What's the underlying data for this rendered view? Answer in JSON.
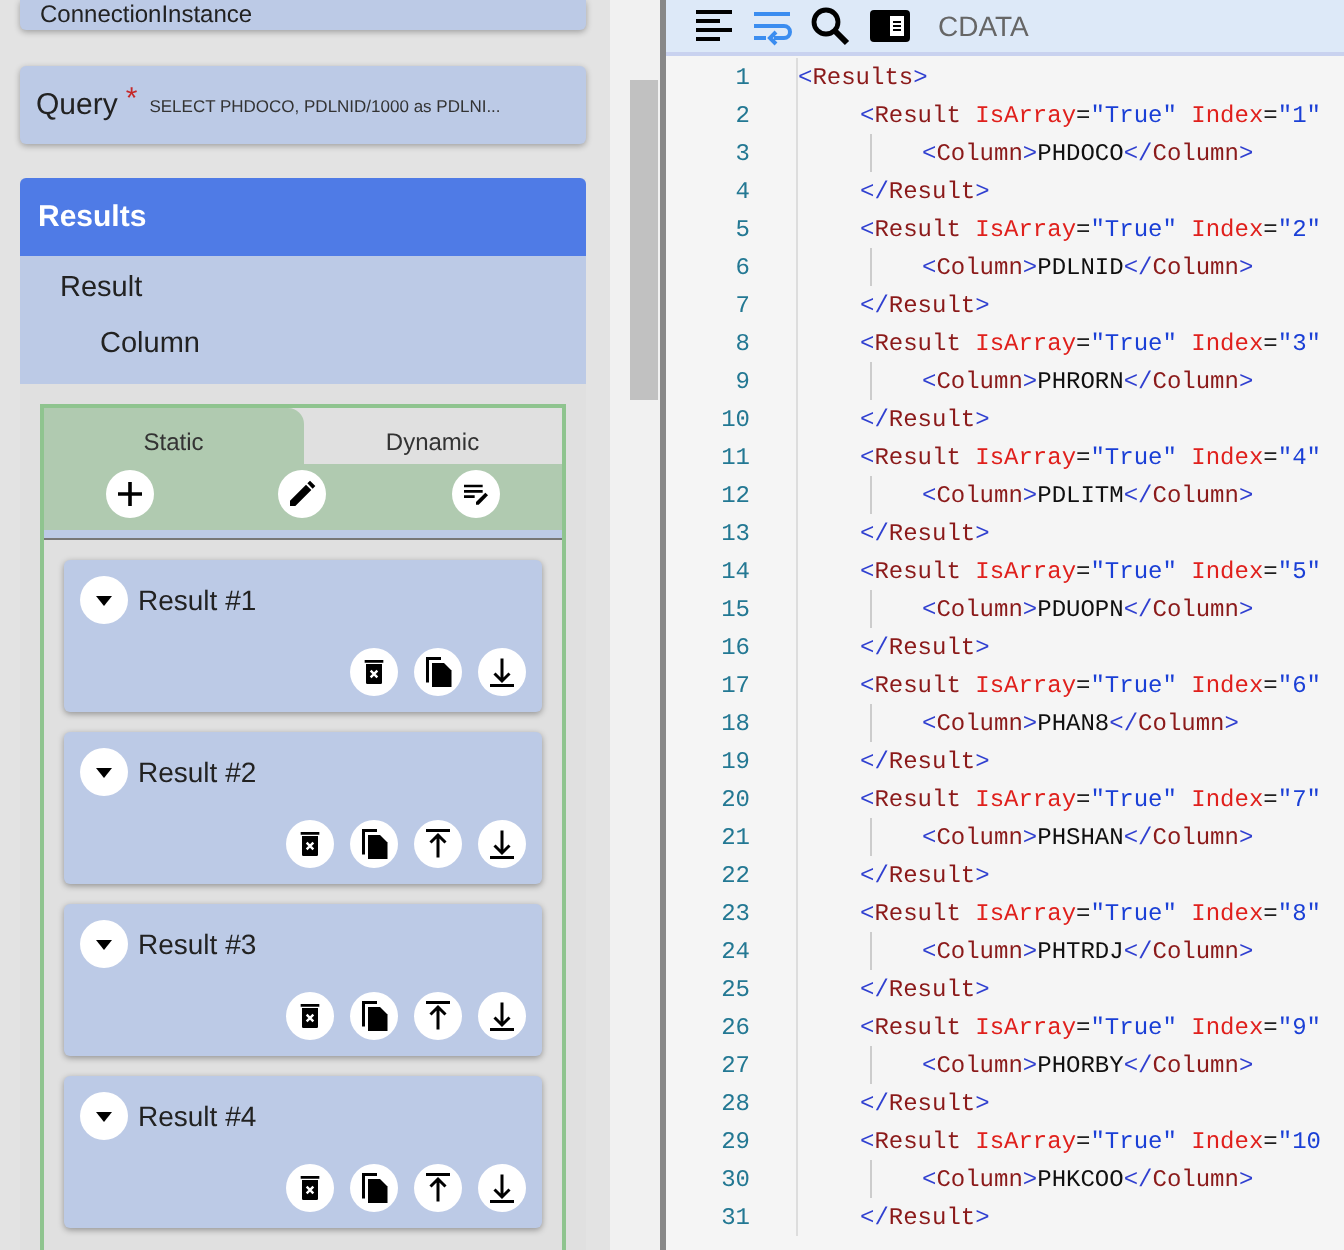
{
  "left_panel": {
    "connection_card": {
      "label": "ConnectionInstance"
    },
    "query": {
      "label": "Query",
      "required_mark": "*",
      "value": "SELECT PHDOCO, PDLNID/1000 as PDLNI..."
    },
    "results_section": {
      "title": "Results",
      "tree": [
        {
          "label": "Result",
          "children": [
            {
              "label": "Column"
            }
          ]
        }
      ],
      "tabs": [
        {
          "label": "Static",
          "selected": true
        },
        {
          "label": "Dynamic",
          "selected": false
        }
      ],
      "tab_actions": [
        {
          "kind": "add"
        },
        {
          "kind": "edit"
        },
        {
          "kind": "edit-list"
        }
      ],
      "results": [
        {
          "title": "Result #1",
          "actions": [
            {
              "kind": "delete"
            },
            {
              "kind": "copy"
            },
            {
              "kind": "move-down"
            }
          ]
        },
        {
          "title": "Result #2",
          "actions": [
            {
              "kind": "delete"
            },
            {
              "kind": "copy"
            },
            {
              "kind": "move-up"
            },
            {
              "kind": "move-down"
            }
          ]
        },
        {
          "title": "Result #3",
          "actions": [
            {
              "kind": "delete"
            },
            {
              "kind": "copy"
            },
            {
              "kind": "move-up"
            },
            {
              "kind": "move-down"
            }
          ]
        },
        {
          "title": "Result #4",
          "actions": [
            {
              "kind": "delete"
            },
            {
              "kind": "copy"
            },
            {
              "kind": "move-up"
            },
            {
              "kind": "move-down"
            }
          ]
        }
      ]
    }
  },
  "editor": {
    "toolbar": [
      {
        "kind": "format",
        "selected": false
      },
      {
        "kind": "wrap",
        "selected": true
      },
      {
        "kind": "search",
        "selected": false
      },
      {
        "kind": "panel",
        "selected": false
      },
      {
        "kind": "text",
        "label": "CDATA",
        "selected": false
      }
    ],
    "lines": [
      {
        "number": "1",
        "tokens": [
          {
            "kind": "bracket",
            "text": "<"
          },
          {
            "kind": "tag",
            "text": "Results"
          },
          {
            "kind": "bracket",
            "text": ">"
          }
        ],
        "children": [
          {
            "number": "2",
            "tokens": [
              {
                "kind": "bracket",
                "text": "<"
              },
              {
                "kind": "tag",
                "text": "Result"
              },
              {
                "kind": "attr",
                "text": " IsArray"
              },
              {
                "kind": "eq",
                "text": "="
              },
              {
                "kind": "value",
                "text": "\"True\""
              },
              {
                "kind": "attr",
                "text": " Index"
              },
              {
                "kind": "eq",
                "text": "="
              },
              {
                "kind": "value",
                "text": "\"1\""
              }
            ],
            "children": [
              {
                "number": "3",
                "tokens": [
                  {
                    "kind": "bracket",
                    "text": "<"
                  },
                  {
                    "kind": "tag",
                    "text": "Column"
                  },
                  {
                    "kind": "bracket",
                    "text": ">"
                  },
                  {
                    "kind": "text",
                    "text": "PHDOCO"
                  },
                  {
                    "kind": "bracket",
                    "text": "</"
                  },
                  {
                    "kind": "tag",
                    "text": "Column"
                  },
                  {
                    "kind": "bracket",
                    "text": ">"
                  }
                ]
              }
            ]
          },
          {
            "number": "4",
            "tokens": [
              {
                "kind": "bracket",
                "text": "</"
              },
              {
                "kind": "tag",
                "text": "Result"
              },
              {
                "kind": "bracket",
                "text": ">"
              }
            ]
          },
          {
            "number": "5",
            "tokens": [
              {
                "kind": "bracket",
                "text": "<"
              },
              {
                "kind": "tag",
                "text": "Result"
              },
              {
                "kind": "attr",
                "text": " IsArray"
              },
              {
                "kind": "eq",
                "text": "="
              },
              {
                "kind": "value",
                "text": "\"True\""
              },
              {
                "kind": "attr",
                "text": " Index"
              },
              {
                "kind": "eq",
                "text": "="
              },
              {
                "kind": "value",
                "text": "\"2\""
              }
            ],
            "children": [
              {
                "number": "6",
                "tokens": [
                  {
                    "kind": "bracket",
                    "text": "<"
                  },
                  {
                    "kind": "tag",
                    "text": "Column"
                  },
                  {
                    "kind": "bracket",
                    "text": ">"
                  },
                  {
                    "kind": "text",
                    "text": "PDLNID"
                  },
                  {
                    "kind": "bracket",
                    "text": "</"
                  },
                  {
                    "kind": "tag",
                    "text": "Column"
                  },
                  {
                    "kind": "bracket",
                    "text": ">"
                  }
                ]
              }
            ]
          },
          {
            "number": "7",
            "tokens": [
              {
                "kind": "bracket",
                "text": "</"
              },
              {
                "kind": "tag",
                "text": "Result"
              },
              {
                "kind": "bracket",
                "text": ">"
              }
            ]
          },
          {
            "number": "8",
            "tokens": [
              {
                "kind": "bracket",
                "text": "<"
              },
              {
                "kind": "tag",
                "text": "Result"
              },
              {
                "kind": "attr",
                "text": " IsArray"
              },
              {
                "kind": "eq",
                "text": "="
              },
              {
                "kind": "value",
                "text": "\"True\""
              },
              {
                "kind": "attr",
                "text": " Index"
              },
              {
                "kind": "eq",
                "text": "="
              },
              {
                "kind": "value",
                "text": "\"3\""
              }
            ],
            "children": [
              {
                "number": "9",
                "tokens": [
                  {
                    "kind": "bracket",
                    "text": "<"
                  },
                  {
                    "kind": "tag",
                    "text": "Column"
                  },
                  {
                    "kind": "bracket",
                    "text": ">"
                  },
                  {
                    "kind": "text",
                    "text": "PHRORN"
                  },
                  {
                    "kind": "bracket",
                    "text": "</"
                  },
                  {
                    "kind": "tag",
                    "text": "Column"
                  },
                  {
                    "kind": "bracket",
                    "text": ">"
                  }
                ]
              }
            ]
          },
          {
            "number": "10",
            "tokens": [
              {
                "kind": "bracket",
                "text": "</"
              },
              {
                "kind": "tag",
                "text": "Result"
              },
              {
                "kind": "bracket",
                "text": ">"
              }
            ]
          },
          {
            "number": "11",
            "tokens": [
              {
                "kind": "bracket",
                "text": "<"
              },
              {
                "kind": "tag",
                "text": "Result"
              },
              {
                "kind": "attr",
                "text": " IsArray"
              },
              {
                "kind": "eq",
                "text": "="
              },
              {
                "kind": "value",
                "text": "\"True\""
              },
              {
                "kind": "attr",
                "text": " Index"
              },
              {
                "kind": "eq",
                "text": "="
              },
              {
                "kind": "value",
                "text": "\"4\""
              }
            ],
            "children": [
              {
                "number": "12",
                "tokens": [
                  {
                    "kind": "bracket",
                    "text": "<"
                  },
                  {
                    "kind": "tag",
                    "text": "Column"
                  },
                  {
                    "kind": "bracket",
                    "text": ">"
                  },
                  {
                    "kind": "text",
                    "text": "PDLITM"
                  },
                  {
                    "kind": "bracket",
                    "text": "</"
                  },
                  {
                    "kind": "tag",
                    "text": "Column"
                  },
                  {
                    "kind": "bracket",
                    "text": ">"
                  }
                ]
              }
            ]
          },
          {
            "number": "13",
            "tokens": [
              {
                "kind": "bracket",
                "text": "</"
              },
              {
                "kind": "tag",
                "text": "Result"
              },
              {
                "kind": "bracket",
                "text": ">"
              }
            ]
          },
          {
            "number": "14",
            "tokens": [
              {
                "kind": "bracket",
                "text": "<"
              },
              {
                "kind": "tag",
                "text": "Result"
              },
              {
                "kind": "attr",
                "text": " IsArray"
              },
              {
                "kind": "eq",
                "text": "="
              },
              {
                "kind": "value",
                "text": "\"True\""
              },
              {
                "kind": "attr",
                "text": " Index"
              },
              {
                "kind": "eq",
                "text": "="
              },
              {
                "kind": "value",
                "text": "\"5\""
              }
            ],
            "children": [
              {
                "number": "15",
                "tokens": [
                  {
                    "kind": "bracket",
                    "text": "<"
                  },
                  {
                    "kind": "tag",
                    "text": "Column"
                  },
                  {
                    "kind": "bracket",
                    "text": ">"
                  },
                  {
                    "kind": "text",
                    "text": "PDUOPN"
                  },
                  {
                    "kind": "bracket",
                    "text": "</"
                  },
                  {
                    "kind": "tag",
                    "text": "Column"
                  },
                  {
                    "kind": "bracket",
                    "text": ">"
                  }
                ]
              }
            ]
          },
          {
            "number": "16",
            "tokens": [
              {
                "kind": "bracket",
                "text": "</"
              },
              {
                "kind": "tag",
                "text": "Result"
              },
              {
                "kind": "bracket",
                "text": ">"
              }
            ]
          },
          {
            "number": "17",
            "tokens": [
              {
                "kind": "bracket",
                "text": "<"
              },
              {
                "kind": "tag",
                "text": "Result"
              },
              {
                "kind": "attr",
                "text": " IsArray"
              },
              {
                "kind": "eq",
                "text": "="
              },
              {
                "kind": "value",
                "text": "\"True\""
              },
              {
                "kind": "attr",
                "text": " Index"
              },
              {
                "kind": "eq",
                "text": "="
              },
              {
                "kind": "value",
                "text": "\"6\""
              }
            ],
            "children": [
              {
                "number": "18",
                "tokens": [
                  {
                    "kind": "bracket",
                    "text": "<"
                  },
                  {
                    "kind": "tag",
                    "text": "Column"
                  },
                  {
                    "kind": "bracket",
                    "text": ">"
                  },
                  {
                    "kind": "text",
                    "text": "PHAN8"
                  },
                  {
                    "kind": "bracket",
                    "text": "</"
                  },
                  {
                    "kind": "tag",
                    "text": "Column"
                  },
                  {
                    "kind": "bracket",
                    "text": ">"
                  }
                ]
              }
            ]
          },
          {
            "number": "19",
            "tokens": [
              {
                "kind": "bracket",
                "text": "</"
              },
              {
                "kind": "tag",
                "text": "Result"
              },
              {
                "kind": "bracket",
                "text": ">"
              }
            ]
          },
          {
            "number": "20",
            "tokens": [
              {
                "kind": "bracket",
                "text": "<"
              },
              {
                "kind": "tag",
                "text": "Result"
              },
              {
                "kind": "attr",
                "text": " IsArray"
              },
              {
                "kind": "eq",
                "text": "="
              },
              {
                "kind": "value",
                "text": "\"True\""
              },
              {
                "kind": "attr",
                "text": " Index"
              },
              {
                "kind": "eq",
                "text": "="
              },
              {
                "kind": "value",
                "text": "\"7\""
              }
            ],
            "children": [
              {
                "number": "21",
                "tokens": [
                  {
                    "kind": "bracket",
                    "text": "<"
                  },
                  {
                    "kind": "tag",
                    "text": "Column"
                  },
                  {
                    "kind": "bracket",
                    "text": ">"
                  },
                  {
                    "kind": "text",
                    "text": "PHSHAN"
                  },
                  {
                    "kind": "bracket",
                    "text": "</"
                  },
                  {
                    "kind": "tag",
                    "text": "Column"
                  },
                  {
                    "kind": "bracket",
                    "text": ">"
                  }
                ]
              }
            ]
          },
          {
            "number": "22",
            "tokens": [
              {
                "kind": "bracket",
                "text": "</"
              },
              {
                "kind": "tag",
                "text": "Result"
              },
              {
                "kind": "bracket",
                "text": ">"
              }
            ]
          },
          {
            "number": "23",
            "tokens": [
              {
                "kind": "bracket",
                "text": "<"
              },
              {
                "kind": "tag",
                "text": "Result"
              },
              {
                "kind": "attr",
                "text": " IsArray"
              },
              {
                "kind": "eq",
                "text": "="
              },
              {
                "kind": "value",
                "text": "\"True\""
              },
              {
                "kind": "attr",
                "text": " Index"
              },
              {
                "kind": "eq",
                "text": "="
              },
              {
                "kind": "value",
                "text": "\"8\""
              }
            ],
            "children": [
              {
                "number": "24",
                "tokens": [
                  {
                    "kind": "bracket",
                    "text": "<"
                  },
                  {
                    "kind": "tag",
                    "text": "Column"
                  },
                  {
                    "kind": "bracket",
                    "text": ">"
                  },
                  {
                    "kind": "text",
                    "text": "PHTRDJ"
                  },
                  {
                    "kind": "bracket",
                    "text": "</"
                  },
                  {
                    "kind": "tag",
                    "text": "Column"
                  },
                  {
                    "kind": "bracket",
                    "text": ">"
                  }
                ]
              }
            ]
          },
          {
            "number": "25",
            "tokens": [
              {
                "kind": "bracket",
                "text": "</"
              },
              {
                "kind": "tag",
                "text": "Result"
              },
              {
                "kind": "bracket",
                "text": ">"
              }
            ]
          },
          {
            "number": "26",
            "tokens": [
              {
                "kind": "bracket",
                "text": "<"
              },
              {
                "kind": "tag",
                "text": "Result"
              },
              {
                "kind": "attr",
                "text": " IsArray"
              },
              {
                "kind": "eq",
                "text": "="
              },
              {
                "kind": "value",
                "text": "\"True\""
              },
              {
                "kind": "attr",
                "text": " Index"
              },
              {
                "kind": "eq",
                "text": "="
              },
              {
                "kind": "value",
                "text": "\"9\""
              }
            ],
            "children": [
              {
                "number": "27",
                "tokens": [
                  {
                    "kind": "bracket",
                    "text": "<"
                  },
                  {
                    "kind": "tag",
                    "text": "Column"
                  },
                  {
                    "kind": "bracket",
                    "text": ">"
                  },
                  {
                    "kind": "text",
                    "text": "PHORBY"
                  },
                  {
                    "kind": "bracket",
                    "text": "</"
                  },
                  {
                    "kind": "tag",
                    "text": "Column"
                  },
                  {
                    "kind": "bracket",
                    "text": ">"
                  }
                ]
              }
            ]
          },
          {
            "number": "28",
            "tokens": [
              {
                "kind": "bracket",
                "text": "</"
              },
              {
                "kind": "tag",
                "text": "Result"
              },
              {
                "kind": "bracket",
                "text": ">"
              }
            ]
          },
          {
            "number": "29",
            "tokens": [
              {
                "kind": "bracket",
                "text": "<"
              },
              {
                "kind": "tag",
                "text": "Result"
              },
              {
                "kind": "attr",
                "text": " IsArray"
              },
              {
                "kind": "eq",
                "text": "="
              },
              {
                "kind": "value",
                "text": "\"True\""
              },
              {
                "kind": "attr",
                "text": " Index"
              },
              {
                "kind": "eq",
                "text": "="
              },
              {
                "kind": "value",
                "text": "\"10"
              }
            ],
            "children": [
              {
                "number": "30",
                "tokens": [
                  {
                    "kind": "bracket",
                    "text": "<"
                  },
                  {
                    "kind": "tag",
                    "text": "Column"
                  },
                  {
                    "kind": "bracket",
                    "text": ">"
                  },
                  {
                    "kind": "text",
                    "text": "PHKCOO"
                  },
                  {
                    "kind": "bracket",
                    "text": "</"
                  },
                  {
                    "kind": "tag",
                    "text": "Column"
                  },
                  {
                    "kind": "bracket",
                    "text": ">"
                  }
                ]
              }
            ]
          },
          {
            "number": "31",
            "tokens": [
              {
                "kind": "bracket",
                "text": "</"
              },
              {
                "kind": "tag",
                "text": "Result"
              },
              {
                "kind": "bracket",
                "text": ">"
              }
            ]
          }
        ]
      }
    ]
  }
}
